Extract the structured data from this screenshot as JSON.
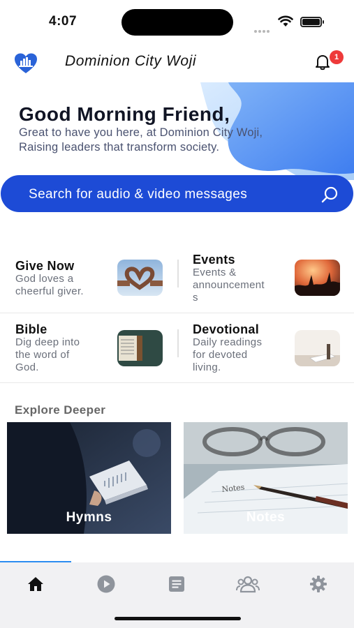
{
  "status_bar": {
    "time": "4:07"
  },
  "header": {
    "title": "Dominion City Woji",
    "notification_count": "1"
  },
  "hero": {
    "greeting": "Good Morning Friend,",
    "line1": "Great to have you here, at Dominion City Woji,",
    "line2": "Raising leaders that transform society."
  },
  "search": {
    "placeholder": "Search for audio & video messages"
  },
  "quick_links": [
    {
      "title": "Give Now",
      "desc": [
        "God loves a",
        "cheerful giver."
      ]
    },
    {
      "title": "Events",
      "desc": [
        "Events &",
        "announcement",
        "s"
      ]
    },
    {
      "title": "Bible",
      "desc": [
        "Dig deep into",
        "the word of",
        "God."
      ]
    },
    {
      "title": "Devotional",
      "desc": [
        "Daily readings",
        "for devoted",
        "living."
      ]
    }
  ],
  "explore": {
    "title": "Explore Deeper",
    "cards": [
      {
        "label": "Hymns"
      },
      {
        "label": "Notes",
        "note_text": "Notes"
      }
    ]
  },
  "tabs": [
    {
      "name": "home",
      "icon": "home-icon",
      "active": true
    },
    {
      "name": "media",
      "icon": "play-icon",
      "active": false
    },
    {
      "name": "notes",
      "icon": "document-icon",
      "active": false
    },
    {
      "name": "community",
      "icon": "people-icon",
      "active": false
    },
    {
      "name": "settings",
      "icon": "gear-icon",
      "active": false
    }
  ],
  "colors": {
    "primary": "#1d4bd6",
    "badge": "#ee3a3a",
    "tab_active": "#111111",
    "tab_inactive": "#8f949c",
    "progress": "#2b8cf0"
  }
}
